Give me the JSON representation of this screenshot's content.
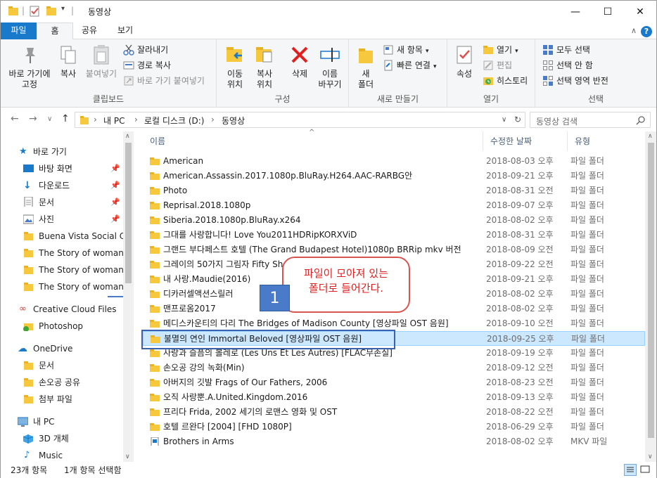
{
  "window": {
    "title": "동영상",
    "controls": {
      "minimize": "—",
      "maximize": "☐",
      "close": "✕"
    }
  },
  "ribbon_tabs": {
    "file": "파일",
    "home": "홈",
    "share": "공유",
    "view": "보기"
  },
  "ribbon": {
    "clipboard": {
      "label": "클립보드",
      "pin": "바로 가기에\n고정",
      "copy": "복사",
      "paste": "붙여넣기",
      "cut": "잘라내기",
      "copy_path": "경로 복사",
      "paste_shortcut": "바로 가기 붙여넣기"
    },
    "organize": {
      "label": "구성",
      "move_to": "이동\n위치",
      "copy_to": "복사\n위치",
      "delete": "삭제",
      "rename": "이름\n바꾸기"
    },
    "new": {
      "label": "새로 만들기",
      "new_folder": "새\n폴더",
      "new_item": "새 항목",
      "easy_access": "빠른 연결"
    },
    "open": {
      "label": "열기",
      "properties": "속성",
      "open": "열기",
      "edit": "편집",
      "history": "히스토리"
    },
    "select": {
      "label": "선택",
      "select_all": "모두 선택",
      "select_none": "선택 안 함",
      "invert": "선택 영역 반전"
    }
  },
  "address": {
    "crumbs": [
      "내 PC",
      "로컬 디스크 (D:)",
      "동영상"
    ],
    "search_placeholder": "동영상 검색"
  },
  "nav_pane": {
    "quick_access": "바로 가기",
    "items": [
      {
        "label": "바탕 화면",
        "pinned": true
      },
      {
        "label": "다운로드",
        "pinned": true
      },
      {
        "label": "문서",
        "pinned": true
      },
      {
        "label": "사진",
        "pinned": true
      },
      {
        "label": "Buena Vista Social Club",
        "pinned": false
      },
      {
        "label": "The Story of woman M",
        "pinned": false
      },
      {
        "label": "The Story of woman M",
        "pinned": false
      },
      {
        "label": "The Story of woman M",
        "pinned": false
      }
    ],
    "creative_cloud": "Creative Cloud Files",
    "photoshop": "Photoshop",
    "onedrive": "OneDrive",
    "onedrive_items": [
      "문서",
      "손오공 공유",
      "첨부 파일"
    ],
    "this_pc": "내 PC",
    "pc_items": [
      "3D 개체",
      "Music"
    ]
  },
  "file_list": {
    "columns": {
      "name": "이름",
      "date": "수정한 날짜",
      "type": "유형"
    },
    "rows": [
      {
        "name": "American",
        "date": "2018-08-03 오후...",
        "type": "파일 폴더"
      },
      {
        "name": "American.Assassin.2017.1080p.BluRay.H264.AAC-RARBG안",
        "date": "2018-09-21 오후...",
        "type": "파일 폴더"
      },
      {
        "name": "Photo",
        "date": "2018-08-31 오전...",
        "type": "파일 폴더"
      },
      {
        "name": "Reprisal.2018.1080p",
        "date": "2018-09-07 오후...",
        "type": "파일 폴더"
      },
      {
        "name": "Siberia.2018.1080p.BluRay.x264",
        "date": "2018-08-02 오후...",
        "type": "파일 폴더"
      },
      {
        "name": "그대를 사랑합니다! Love You2011HDRipKORXViD",
        "date": "2018-08-31 오후...",
        "type": "파일 폴더"
      },
      {
        "name": "그랜드 부다페스트 호텔 (The Grand Budapest Hotel)1080p BRRip mkv 버전",
        "date": "2018-08-09 오전...",
        "type": "파일 폴더"
      },
      {
        "name": "그레이의 50가지 그림자 Fifty Sh... OST]",
        "date": "2018-09-22 오전...",
        "type": "파일 폴더"
      },
      {
        "name": "내 사랑.Maudie(2016)",
        "date": "2018-09-21 오후...",
        "type": "파일 폴더"
      },
      {
        "name": "디카러셀액션스릴러",
        "date": "2018-08-02 오후...",
        "type": "파일 폴더"
      },
      {
        "name": "맨프로옴2017",
        "date": "2018-08-02 오후...",
        "type": "파일 폴더"
      },
      {
        "name": "메디스카운티의 다리 The Bridges of Madison County [영상파일 OST 음원]",
        "date": "2018-09-10 오전...",
        "type": "파일 폴더"
      },
      {
        "name": "불멸의 연인 Immortal Beloved [영상파일 OST 음원]",
        "date": "2018-09-25 오후...",
        "type": "파일 폴더",
        "selected": true
      },
      {
        "name": "사랑과 슬픔의 볼레로 (Les Uns Et Les Autres) [FLAC무손실]",
        "date": "2018-09-19 오후...",
        "type": "파일 폴더"
      },
      {
        "name": "손오공 강의 녹화(Min)",
        "date": "2018-09-12 오전...",
        "type": "파일 폴더"
      },
      {
        "name": "아버지의 깃발 Frags of Our Fathers, 2006",
        "date": "2018-08-23 오전...",
        "type": "파일 폴더"
      },
      {
        "name": "오직 사랑뿐.A.United.Kingdom.2016",
        "date": "2018-09-13 오후...",
        "type": "파일 폴더"
      },
      {
        "name": "프리다 Frida, 2002 세기의 로맨스 영화 및 OST",
        "date": "2018-08-22 오전...",
        "type": "파일 폴더"
      },
      {
        "name": "호텔 르완다 [2004] [FHD 1080P]",
        "date": "2018-06-29 오후...",
        "type": "파일 폴더"
      },
      {
        "name": "Brothers in Arms",
        "date": "2018-08-02 오후...",
        "type": "MKV 파일"
      }
    ]
  },
  "status": {
    "count": "23개 항목",
    "selected": "1개 항목 선택함"
  },
  "annotation": {
    "callout": "파일이 모아져 있는\n폴더로 들어간다.",
    "badge": "1"
  },
  "colors": {
    "accent": "#1979ca",
    "selection": "#cce8ff",
    "folder": "#f5c83d",
    "callout_border": "#d9534f",
    "badge": "#4a7bc8"
  }
}
